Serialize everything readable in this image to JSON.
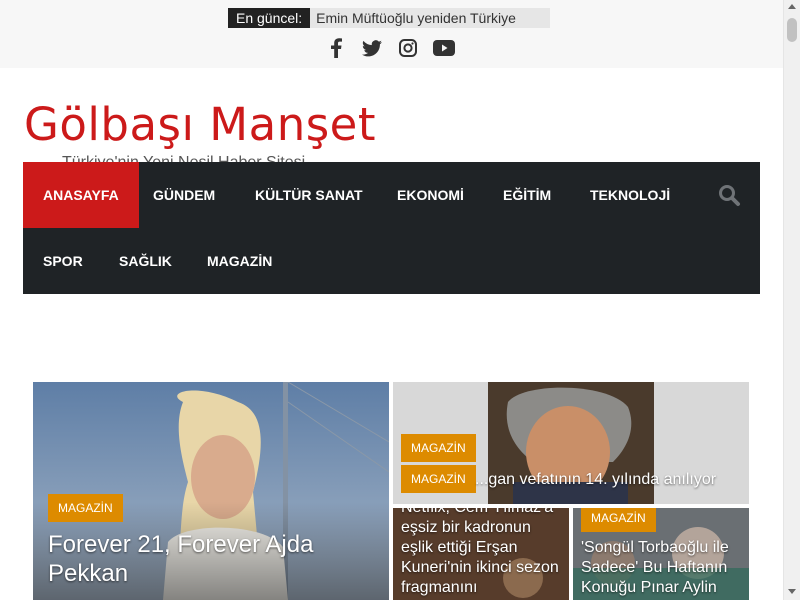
{
  "ticker": {
    "label": "En güncel:",
    "text": "Emin Müftüoğlu yeniden Türkiye"
  },
  "social": {
    "icons": [
      "facebook-icon",
      "twitter-icon",
      "instagram-icon",
      "youtube-icon"
    ]
  },
  "site": {
    "title": "Gölbaşı Manşet",
    "tagline": "Türkiye'nin Yeni Nesil Haber Sitesi"
  },
  "nav": {
    "items": [
      "ANASAYFA",
      "GÜNDEM",
      "KÜLTÜR SANAT",
      "EKONOMİ",
      "EĞİTİM",
      "TEKNOLOJİ",
      "SPOR",
      "SAĞLIK",
      "MAGAZİN"
    ],
    "active_index": 0
  },
  "featured": {
    "main": {
      "category": "MAGAZİN",
      "title": "Forever 21, Forever Ajda Pekkan"
    },
    "top_right": {
      "category_1": "MAGAZİN",
      "category_2": "MAGAZİN",
      "title": "...gan vefatının 14. yılında anılıyor"
    },
    "bottom_left": {
      "title": "Netflix, Cem Yılmaz'a eşsiz bir kadronun eşlik ettiği Erşan Kuneri'nin ikinci sezon fragmanını"
    },
    "bottom_right": {
      "category": "MAGAZİN",
      "title": "'Songül Torbaoğlu ile Sadece' Bu Haftanın Konuğu Pınar Aylin"
    }
  },
  "colors": {
    "brand_red": "#cc1a1a",
    "nav_bg": "#1f2326",
    "category_orange": "#dd8b00"
  }
}
